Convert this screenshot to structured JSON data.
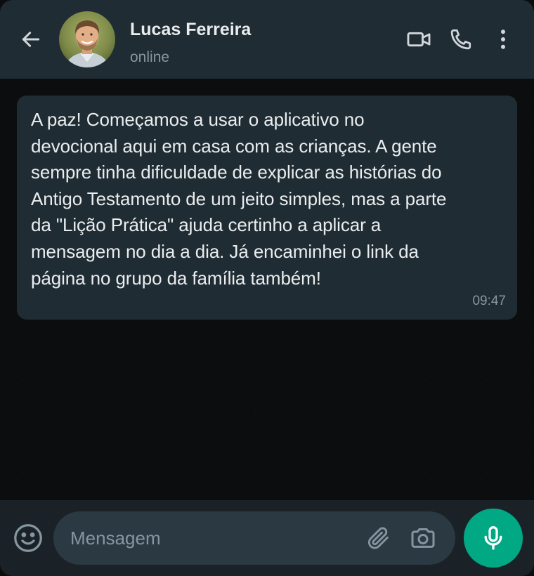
{
  "header": {
    "contact_name": "Lucas Ferreira",
    "contact_status": "online",
    "icons": {
      "back": "arrow-left-icon",
      "video": "video-camera-icon",
      "call": "phone-icon",
      "menu": "more-vertical-icon"
    }
  },
  "messages": [
    {
      "direction": "incoming",
      "text": "A paz! Começamos a usar o aplicativo no\ndevocional aqui em casa com as crianças. A gente\nsempre tinha dificuldade de explicar as histórias do\nAntigo Testamento de um jeito simples, mas a parte\nda \"Lição Prática\" ajuda certinho a aplicar a\nmensagem no dia a dia. Já encaminhei o link da\npágina no grupo da família também!",
      "time": "09:47"
    }
  ],
  "composer": {
    "placeholder": "Mensagem",
    "value": "",
    "icons": {
      "emoji": "emoji-icon",
      "attach": "paperclip-icon",
      "camera": "camera-icon",
      "mic": "microphone-icon"
    }
  },
  "colors": {
    "header_bg": "#202c33",
    "chat_bg": "#0b0d0e",
    "bubble_bg": "#202c33",
    "input_bg": "#2a3942",
    "accent": "#00a884",
    "text_primary": "#e9edef",
    "text_secondary": "#8696a0"
  }
}
